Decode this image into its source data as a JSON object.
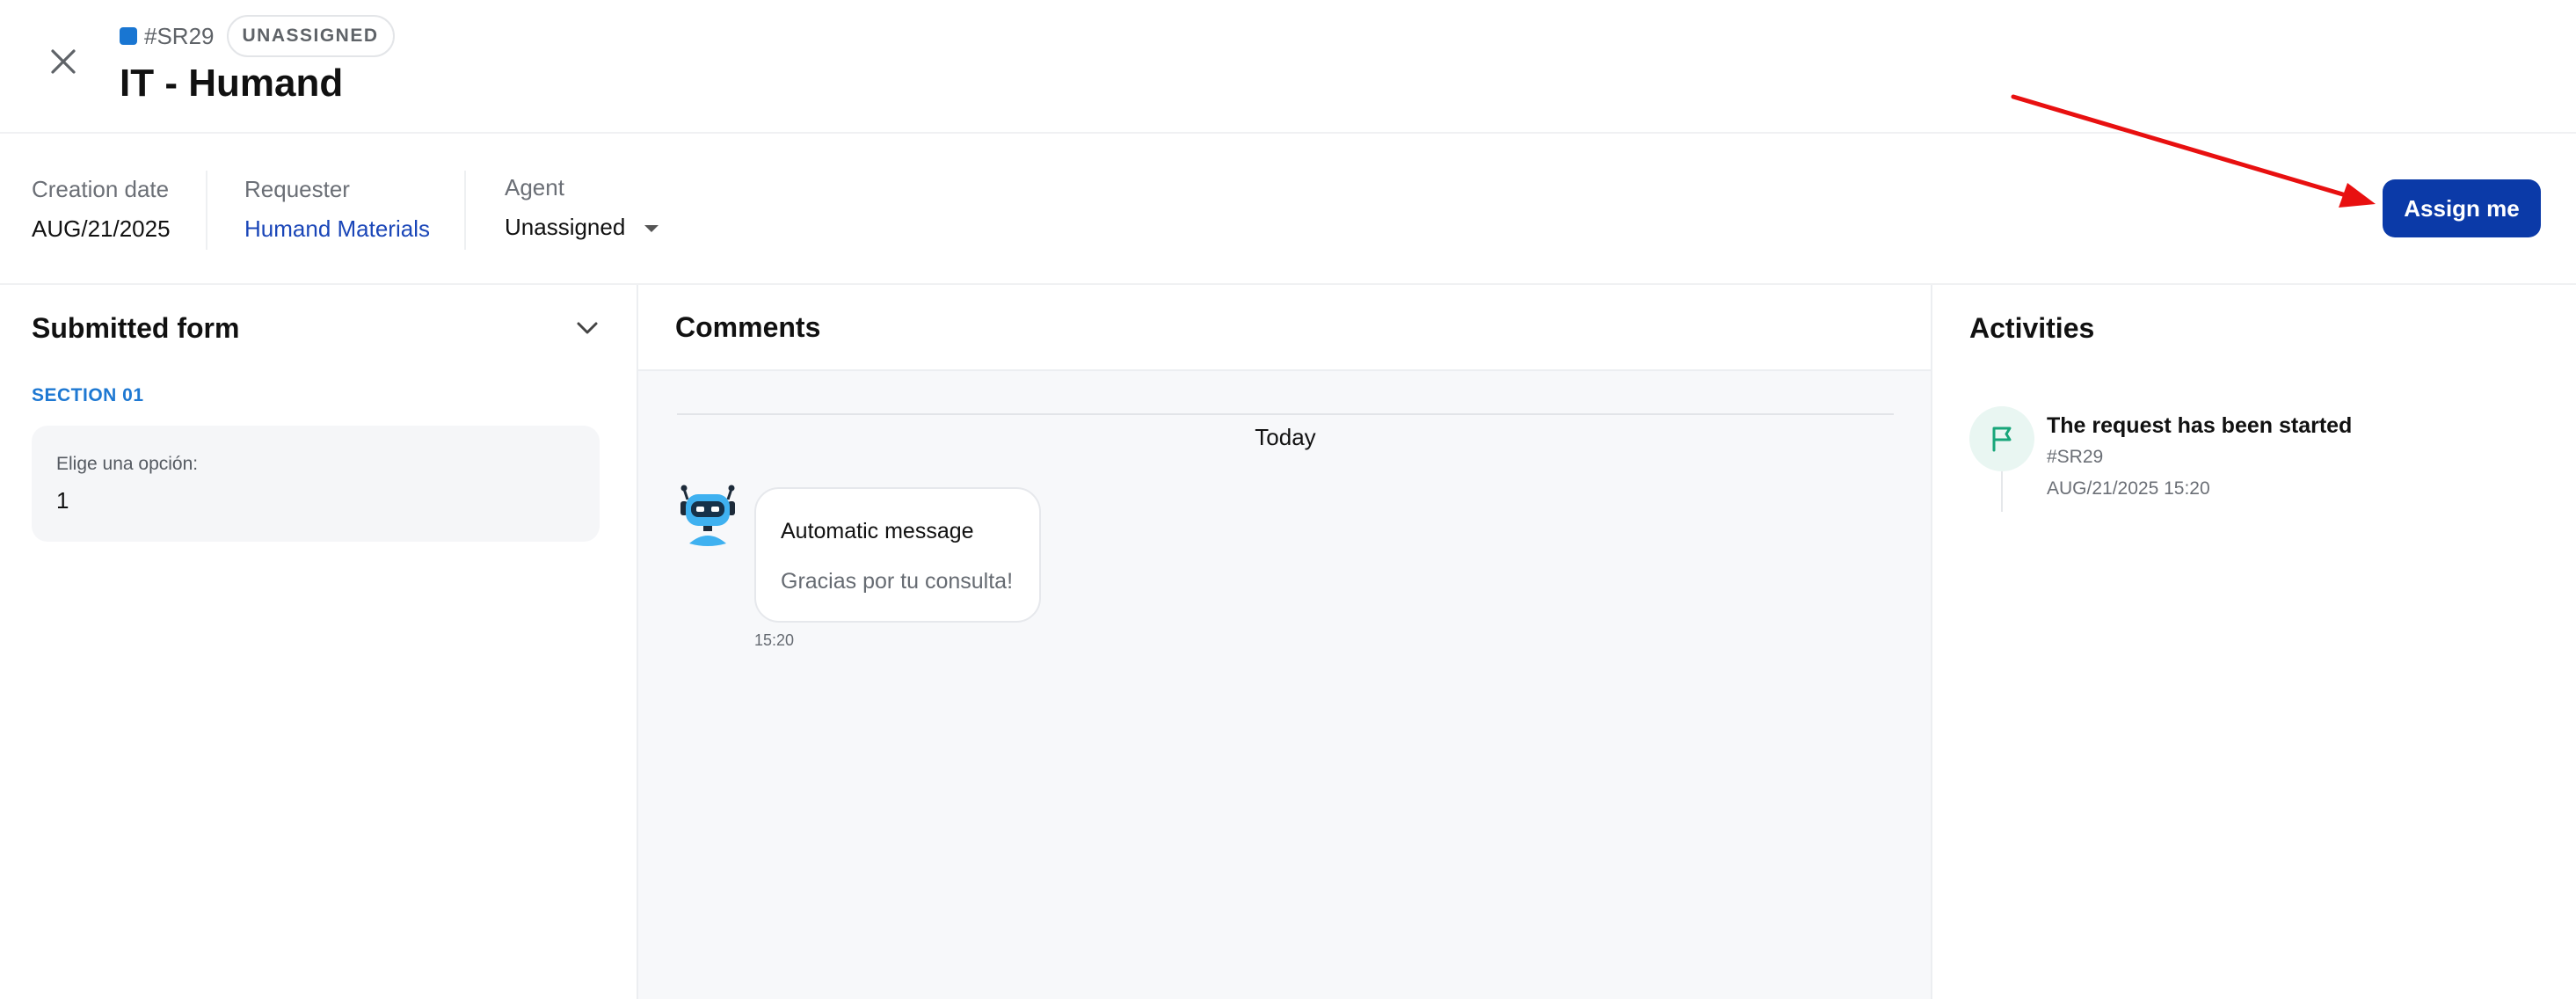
{
  "header": {
    "request_id": "#SR29",
    "status_badge": "UNASSIGNED",
    "title": "IT - Humand"
  },
  "info": {
    "creation_date_label": "Creation date",
    "creation_date_value": "AUG/21/2025",
    "requester_label": "Requester",
    "requester_value": "Humand Materials",
    "agent_label": "Agent",
    "agent_value": "Unassigned",
    "assign_button": "Assign me"
  },
  "form": {
    "title": "Submitted form",
    "section_label": "SECTION 01",
    "field_label": "Elige una opción:",
    "field_value": "1"
  },
  "comments": {
    "title": "Comments",
    "date_divider": "Today",
    "message_title": "Automatic message",
    "message_text": "Gracias por tu consulta!",
    "message_time": "15:20"
  },
  "activities": {
    "title": "Activities",
    "item_title": "The request has been started",
    "item_sub": "#SR29",
    "item_date": "AUG/21/2025 15:20"
  },
  "colors": {
    "primary": "#0b3aa8",
    "link": "#1a46b8",
    "section_accent": "#1e78d2",
    "activity_icon": "#18a67a",
    "annotation_arrow": "#e81010"
  },
  "icons": {
    "close": "close-icon",
    "dropdown": "caret-down-icon",
    "collapse": "chevron-down-icon",
    "bot": "robot-icon",
    "activity": "flag-icon"
  }
}
